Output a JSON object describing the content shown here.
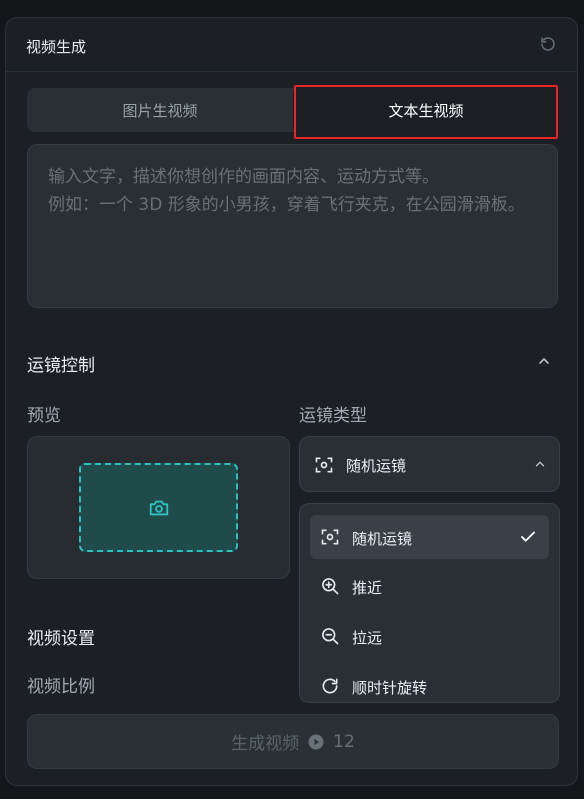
{
  "header": {
    "title": "视频生成"
  },
  "tabs": [
    {
      "label": "图片生视频"
    },
    {
      "label": "文本生视频"
    }
  ],
  "prompt": {
    "placeholder": "输入文字，描述你想创作的画面内容、运动方式等。\n例如：一个 3D 形象的小男孩，穿着飞行夹克，在公园滑滑板。",
    "value": ""
  },
  "camera": {
    "title": "运镜控制",
    "preview_label": "预览",
    "type_label": "运镜类型",
    "selected": "随机运镜",
    "options": [
      {
        "label": "随机运镜",
        "icon": "random-camera-icon",
        "selected": true
      },
      {
        "label": "推近",
        "icon": "zoom-in-icon",
        "selected": false
      },
      {
        "label": "拉远",
        "icon": "zoom-out-icon",
        "selected": false
      },
      {
        "label": "顺时针旋转",
        "icon": "rotate-clockwise-icon",
        "selected": false
      }
    ]
  },
  "video_settings": {
    "title": "视频设置",
    "ratio_label": "视频比例"
  },
  "generate": {
    "label": "生成视频",
    "cost": "12"
  },
  "colors": {
    "accent": "#2fc2c0",
    "highlight_border": "#e8262a",
    "panel_bg": "#1c1f24"
  }
}
